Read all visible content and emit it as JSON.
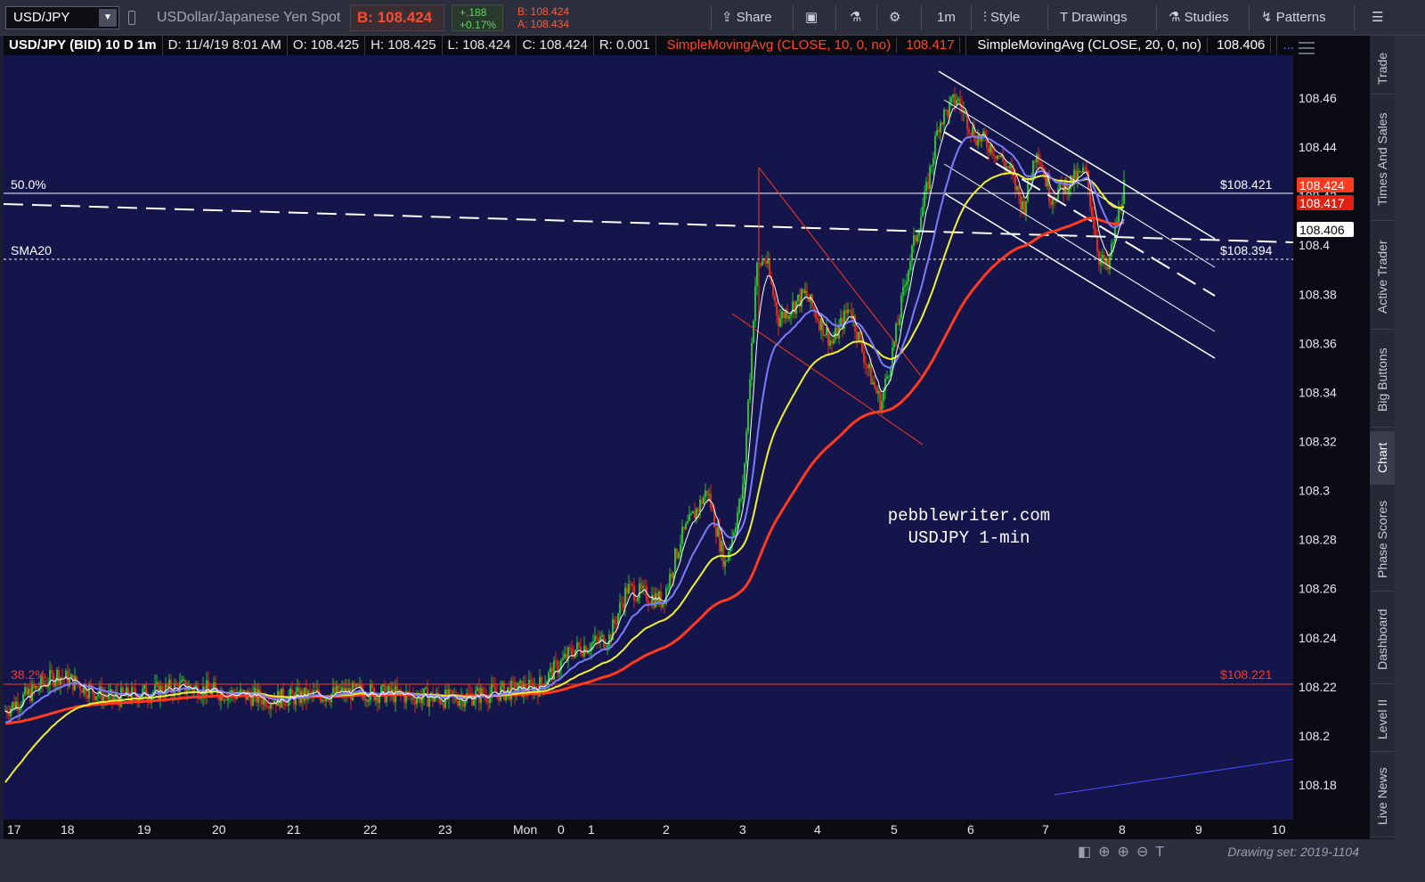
{
  "toolbar": {
    "symbol": "USD/JPY",
    "symbol_description": "USDollar/Japanese Yen Spot",
    "bid": "B: 108.424",
    "change_abs": "+.188",
    "change_pct": "+0.17%",
    "bid_small": "B: 108.424",
    "ask_small": "A: 108.434",
    "buttons": {
      "share": "Share",
      "timeframe": "1m",
      "style": "Style",
      "drawings": "Drawings",
      "studies": "Studies",
      "patterns": "Patterns"
    }
  },
  "infobar": {
    "title": "USD/JPY (BID) 10 D 1m",
    "date": "D: 11/4/19 8:01 AM",
    "open": "O: 108.425",
    "high": "H: 108.425",
    "low": "L: 108.424",
    "close": "C: 108.424",
    "range": "R: 0.001",
    "sma10": "SimpleMovingAvg (CLOSE, 10, 0, no)",
    "sma10_val": "108.417",
    "sma20": "SimpleMovingAvg (CLOSE, 20, 0, no)",
    "sma20_val": "108.406",
    "more": "..."
  },
  "chart": {
    "watermark_line1": "pebblewriter.com",
    "watermark_line2": "USDJPY 1-min",
    "fib50_label": "50.0%",
    "fib50_price": "$108.421",
    "fib382_label": "38.2%",
    "fib382_price": "$108.221",
    "sma20_label": "SMA20",
    "sma20_price": "$108.394",
    "price_ticks": [
      "108.46",
      "108.44",
      "108.42",
      "108.4",
      "108.38",
      "108.36",
      "108.34",
      "108.32",
      "108.3",
      "108.28",
      "108.26",
      "108.24",
      "108.22",
      "108.2",
      "108.18"
    ],
    "price_tags": [
      {
        "label": "108.424",
        "color": "#ff3a1e"
      },
      {
        "label": "108.417",
        "color": "#e02010"
      },
      {
        "label": "108.406",
        "color": "#ffffff"
      }
    ],
    "time_ticks": [
      "17",
      "18",
      "19",
      "20",
      "21",
      "22",
      "23",
      "Mon",
      "0",
      "1",
      "2",
      "3",
      "4",
      "5",
      "6",
      "7",
      "8",
      "9",
      "10"
    ],
    "colors": {
      "background": "#14154a",
      "sma_red": "#ff3a1e",
      "sma_yellow": "#f2f22a",
      "sma_blue": "#7b7cff",
      "sma_white": "#ffffff",
      "fib_red": "#ff3a1e"
    }
  },
  "side_tabs": [
    "Trade",
    "Times And Sales",
    "Active Trader",
    "Big Buttons",
    "Chart",
    "Phase Scores",
    "Dashboard",
    "Level II",
    "Live News"
  ],
  "bottom": {
    "drawing_set": "Drawing set: 2019-1104"
  }
}
